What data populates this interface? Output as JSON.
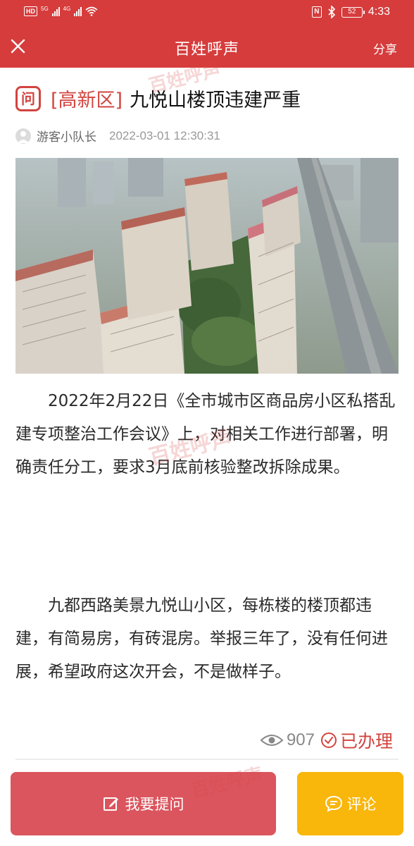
{
  "status_bar": {
    "hd": "HD",
    "net1": "5G",
    "net2": "4G",
    "nfc": "N",
    "battery": "52",
    "time": "4:33"
  },
  "header": {
    "title": "百姓呼声",
    "share": "分享"
  },
  "article": {
    "district": "[高新区]",
    "title": "九悦山楼顶违建严重",
    "author": "游客小队长",
    "datetime": "2022-03-01 12:30:31",
    "paragraphs": [
      "2022年2月22日《全市城市区商品房小区私搭乱建专项整治工作会议》上，对相关工作进行部署，明确责任分工，要求3月底前核验整改拆除成果。",
      "九都西路美景九悦山小区，每栋楼的楼顶都违建，有简易房，有砖混房。举报三年了，没有任何进展，希望政府这次开会，不是做样子。"
    ],
    "views": "907",
    "status": "已办理"
  },
  "actions": {
    "ask": "我要提问",
    "comment": "评论"
  },
  "watermark": "百姓呼声",
  "colors": {
    "header_red": "#d63c3c",
    "accent_red": "#d2443f",
    "ask_button": "#db555e",
    "comment_button": "#f9b60b"
  }
}
